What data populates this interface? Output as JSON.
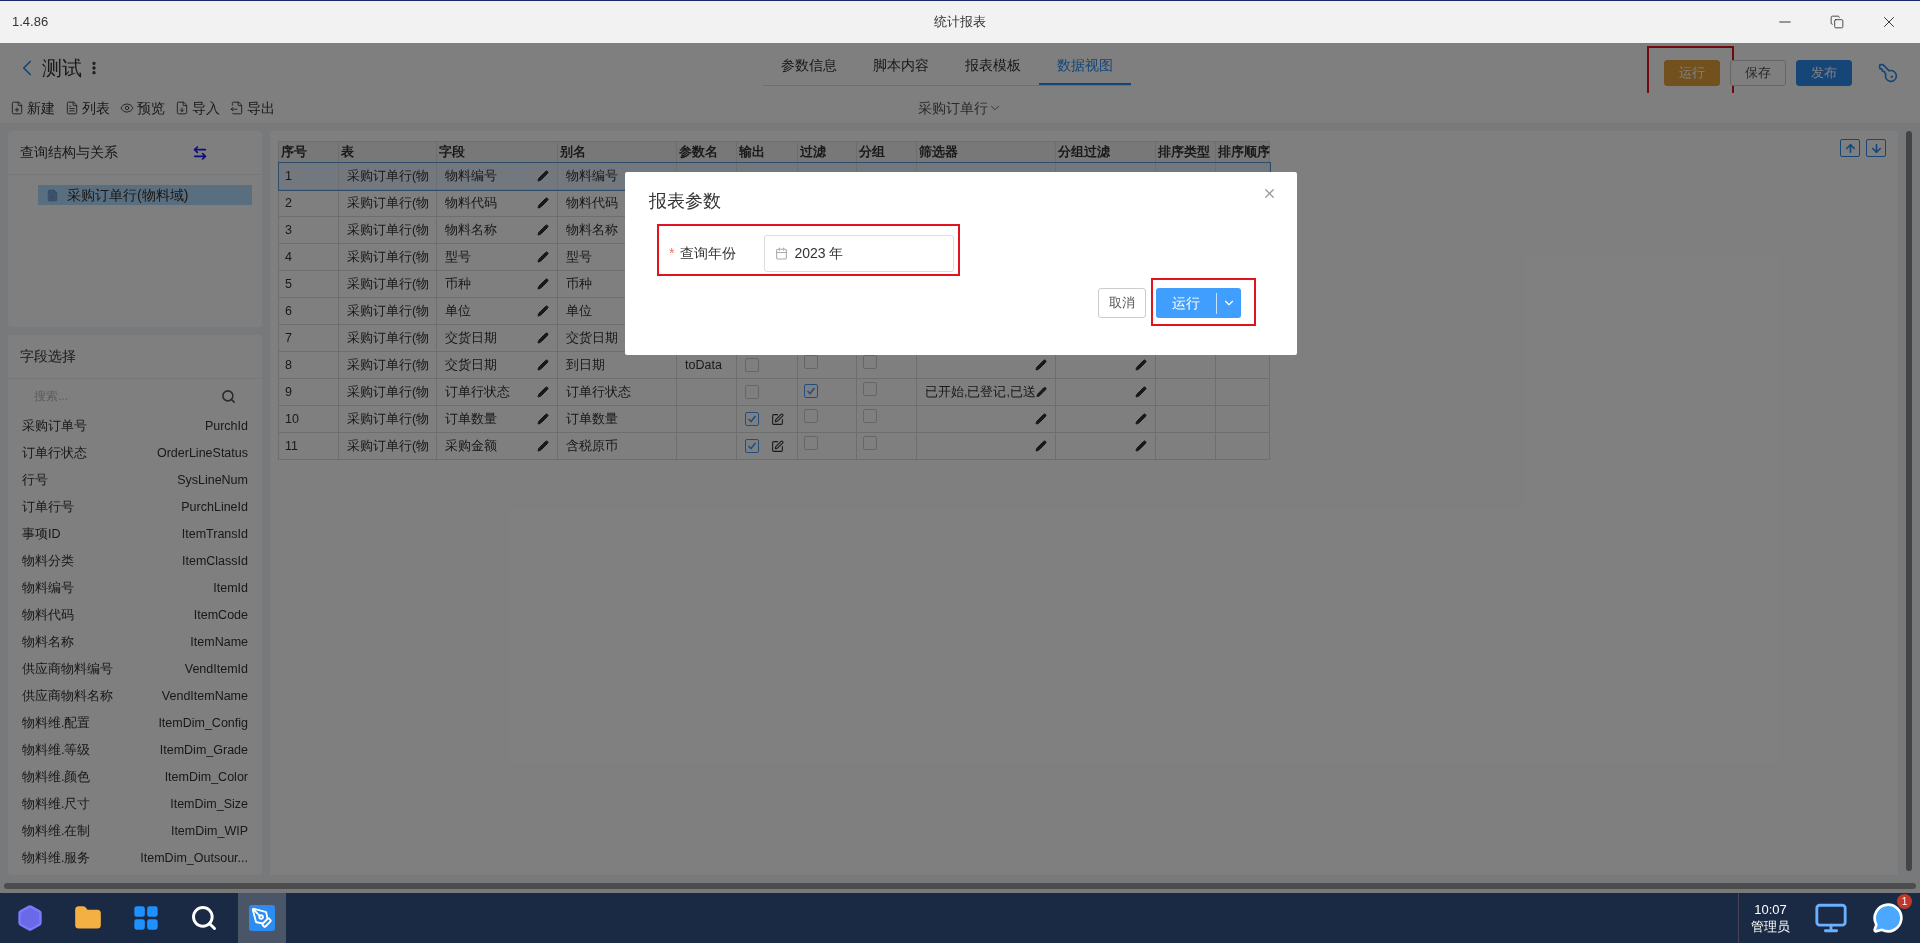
{
  "window": {
    "version": "1.4.86",
    "title": "统计报表"
  },
  "header": {
    "title": "测试",
    "tabs": [
      {
        "label": "参数信息",
        "selected": false
      },
      {
        "label": "脚本内容",
        "selected": false
      },
      {
        "label": "报表模板",
        "selected": false
      },
      {
        "label": "数据视图",
        "selected": true
      }
    ],
    "buttons": [
      {
        "label": "运行",
        "kind": "warning",
        "highlighted": true
      },
      {
        "label": "保存",
        "kind": "default",
        "highlighted": false
      },
      {
        "label": "发布",
        "kind": "primary",
        "highlighted": false
      }
    ]
  },
  "toolbar": {
    "items": [
      "新建",
      "列表",
      "预览",
      "导入",
      "导出"
    ],
    "view_select": "采购订单行"
  },
  "query_panel": {
    "title": "查询结构与关系",
    "tree": [
      {
        "label": "采购订单行(物料域)",
        "selected": true
      }
    ]
  },
  "field_panel": {
    "title": "字段选择",
    "search": {
      "placeholder": "搜索..."
    },
    "fields": [
      {
        "label": "采购订单号",
        "code": "PurchId"
      },
      {
        "label": "订单行状态",
        "code": "OrderLineStatus"
      },
      {
        "label": "行号",
        "code": "SysLineNum"
      },
      {
        "label": "订单行号",
        "code": "PurchLineId"
      },
      {
        "label": "事项ID",
        "code": "ItemTransId"
      },
      {
        "label": "物料分类",
        "code": "ItemClassId"
      },
      {
        "label": "物料编号",
        "code": "ItemId"
      },
      {
        "label": "物料代码",
        "code": "ItemCode"
      },
      {
        "label": "物料名称",
        "code": "ItemName"
      },
      {
        "label": "供应商物料编号",
        "code": "VendItemId"
      },
      {
        "label": "供应商物料名称",
        "code": "VendItemName"
      },
      {
        "label": "物料维.配置",
        "code": "ItemDim_Config"
      },
      {
        "label": "物料维.等级",
        "code": "ItemDim_Grade"
      },
      {
        "label": "物料维.颜色",
        "code": "ItemDim_Color"
      },
      {
        "label": "物料维.尺寸",
        "code": "ItemDim_Size"
      },
      {
        "label": "物料维.在制",
        "code": "ItemDim_WIP"
      },
      {
        "label": "物料维.服务",
        "code": "ItemDim_Outsour..."
      }
    ]
  },
  "table": {
    "columns": [
      "序号",
      "表",
      "字段",
      "别名",
      "参数名",
      "输出",
      "过滤",
      "分组",
      "筛选器",
      "分组过滤",
      "排序类型",
      "排序顺序"
    ],
    "rows": [
      {
        "no": "1",
        "table": "采购订单行(物",
        "field": "物料编号",
        "alias": "物料编号",
        "selected": true
      },
      {
        "no": "2",
        "table": "采购订单行(物",
        "field": "物料代码",
        "alias": "物料代码",
        "selected": false
      },
      {
        "no": "3",
        "table": "采购订单行(物",
        "field": "物料名称",
        "alias": "物料名称",
        "selected": false
      },
      {
        "no": "4",
        "table": "采购订单行(物",
        "field": "型号",
        "alias": "型号",
        "selected": false
      },
      {
        "no": "5",
        "table": "采购订单行(物",
        "field": "币种",
        "alias": "币种",
        "selected": false
      },
      {
        "no": "6",
        "table": "采购订单行(物",
        "field": "单位",
        "alias": "单位",
        "selected": false
      },
      {
        "no": "7",
        "table": "采购订单行(物",
        "field": "交货日期",
        "alias": "交货日期",
        "selected": false
      },
      {
        "no": "8",
        "table": "采购订单行(物",
        "field": "交货日期",
        "alias": "到日期",
        "param": "toData",
        "output": false,
        "filter": false,
        "group": false,
        "selected": false
      },
      {
        "no": "9",
        "table": "采购订单行(物",
        "field": "订单行状态",
        "alias": "订单行状态",
        "output": false,
        "filter": true,
        "group": false,
        "filter_text": "已开始,已登记,已送",
        "selected": false
      },
      {
        "no": "10",
        "table": "采购订单行(物",
        "field": "订单数量",
        "alias": "订单数量",
        "output": true,
        "filter": false,
        "group": false,
        "selected": false
      },
      {
        "no": "11",
        "table": "采购订单行(物",
        "field": "采购金额",
        "alias": "含税原币",
        "output": true,
        "filter": false,
        "group": false,
        "selected": false
      }
    ]
  },
  "dialog": {
    "title": "报表参数",
    "field": {
      "required_mark": "*",
      "label": "查询年份",
      "value": "2023 年",
      "highlighted": true
    },
    "buttons": [
      {
        "label": "取消",
        "kind": "default",
        "highlighted": false
      },
      {
        "label": "运行",
        "kind": "primary",
        "highlighted": true
      }
    ]
  },
  "taskbar": {
    "time": "10:07",
    "user": "管理员",
    "badge": "1"
  }
}
